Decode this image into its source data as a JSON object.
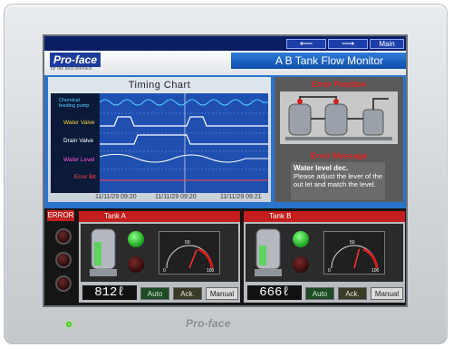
{
  "bezel": {
    "brand": "Pro-face"
  },
  "header": {
    "logo": "Pro-face",
    "tagline": "for the best interface",
    "title": "A B Tank Flow Monitor",
    "nav_back": "⟵",
    "nav_forward": "⟶",
    "nav_main": "Main"
  },
  "chart": {
    "title": "Timing Chart",
    "signals": [
      {
        "label": "Chemical feeding pump",
        "color": "#56d1ff"
      },
      {
        "label": "Water Valve",
        "color": "#f7d43b"
      },
      {
        "label": "Drain Valve",
        "color": "#ffffff"
      },
      {
        "label": "Water Level",
        "color": "#ff5ad8"
      },
      {
        "label": "Error Bit",
        "color": "#ff4444"
      }
    ],
    "times": [
      "11/11/29 09:20",
      "11/11/29 09:20",
      "11/11/29 09:21"
    ]
  },
  "error_position": {
    "title": "Error Position"
  },
  "error_message": {
    "title": "Error Message",
    "heading": "Water level dec.",
    "text": "Please adjust the lever of the out let and match the level."
  },
  "error_panel": {
    "label": "ERROR"
  },
  "tank_a": {
    "name": "Tank A",
    "level": "812ℓ",
    "auto": "Auto",
    "ack": "Ack.",
    "manual": "Manual",
    "gauge_ticks": [
      "0",
      "10",
      "20",
      "30",
      "40",
      "50",
      "60",
      "70",
      "80",
      "90",
      "100"
    ],
    "needle_percent": 62
  },
  "tank_b": {
    "name": "Tank B",
    "level": "666ℓ",
    "auto": "Auto",
    "ack": "Ack.",
    "manual": "Manual",
    "gauge_ticks": [
      "0",
      "10",
      "20",
      "30",
      "40",
      "50",
      "60",
      "70",
      "80",
      "90",
      "100"
    ],
    "needle_percent": 58
  },
  "colors": {
    "accent_blue": "#2a74cc",
    "alarm_red": "#c41d1d",
    "lamp_green": "#24c236"
  }
}
